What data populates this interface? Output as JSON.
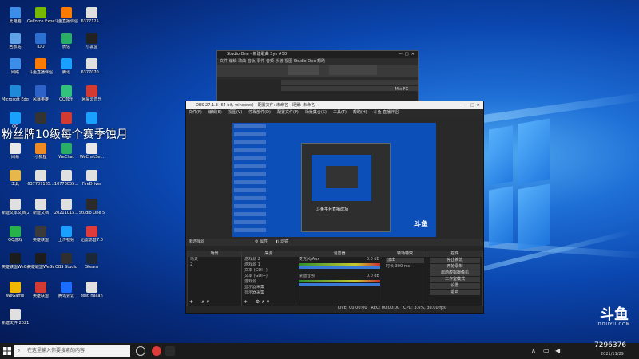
{
  "desktop_icons": [
    {
      "label": "此电脑",
      "color": "#3d8ee8"
    },
    {
      "label": "GeForce Experience",
      "color": "#76b900"
    },
    {
      "label": "斗鱼直播伴侣",
      "color": "#ff7a00"
    },
    {
      "label": "6377125...",
      "color": "#e0e0e0"
    },
    {
      "label": "回收站",
      "color": "#5fa2e8"
    },
    {
      "label": "IDO",
      "color": "#2b6fd1"
    },
    {
      "label": "微信",
      "color": "#2aae67"
    },
    {
      "label": "小黑盒",
      "color": "#222222"
    },
    {
      "label": "网络",
      "color": "#3d8ee8"
    },
    {
      "label": "斗鱼直播伴侣",
      "color": "#ff7a00"
    },
    {
      "label": "腾讯",
      "color": "#1aa1ff"
    },
    {
      "label": "6377070...",
      "color": "#e0e0e0"
    },
    {
      "label": "Microsoft Edge",
      "color": "#1f8ad8"
    },
    {
      "label": "风暴英雄",
      "color": "#2d62c9"
    },
    {
      "label": "QQ音乐",
      "color": "#31c27c"
    },
    {
      "label": "网易云音乐",
      "color": "#d33a31"
    },
    {
      "label": "QQ",
      "color": "#1aa1ff"
    },
    {
      "label": "",
      "color": "#333333"
    },
    {
      "label": "",
      "color": "#d33a31"
    },
    {
      "label": "",
      "color": "#1aa1ff"
    },
    {
      "label": "网易",
      "color": "#e8e8e8"
    },
    {
      "label": "小狐狸",
      "color": "#f08a24"
    },
    {
      "label": "WeChat",
      "color": "#2aae67"
    },
    {
      "label": "WeChatSe...",
      "color": "#e8e8e8"
    },
    {
      "label": "工具",
      "color": "#e6b84a"
    },
    {
      "label": "637707165...",
      "color": "#e0e0e0"
    },
    {
      "label": "10776055...",
      "color": "#e0e0e0"
    },
    {
      "label": "FireDriver",
      "color": "#e0e0e0"
    },
    {
      "label": "新建文本文档(2)",
      "color": "#e0e0e0"
    },
    {
      "label": "新建文档",
      "color": "#e0e0e0"
    },
    {
      "label": "20211015...",
      "color": "#e0e0e0"
    },
    {
      "label": "Studio One 5",
      "color": "#2b2b2b"
    },
    {
      "label": "QQ游戏",
      "color": "#28b34a"
    },
    {
      "label": "英雄联盟",
      "color": "#3a3a3a"
    },
    {
      "label": "上传视频",
      "color": "#1aa1ff"
    },
    {
      "label": "迅雷影音7.0",
      "color": "#e03b3b"
    },
    {
      "label": "英雄联盟WeGame版",
      "color": "#1c1c1c"
    },
    {
      "label": "英雄联盟WeGame版",
      "color": "#1c1c1c"
    },
    {
      "label": "OBS Studio",
      "color": "#2f2f2f"
    },
    {
      "label": "Steam",
      "color": "#1b2838"
    },
    {
      "label": "WeGame",
      "color": "#f2b600"
    },
    {
      "label": "英雄联盟",
      "color": "#d33a31"
    },
    {
      "label": "腾讯会议",
      "color": "#1a6dff"
    },
    {
      "label": "test_hallan",
      "color": "#e0e0e0"
    },
    {
      "label": "新建文件 20211103...",
      "color": "#e0e0e0"
    }
  ],
  "overlay_caption": "粉丝牌10级每个赛季蚀月",
  "small_window": {
    "title": "Studio One - 新建歌曲 Sys #50",
    "menu": "文件  编辑  歌曲  音轨  事件  音频  乐谱  视图  Studio One  帮助",
    "right_label": "Mix  FX"
  },
  "obs": {
    "title": "OBS 27.1.3 (64 bit, windows) - 配置文件: 未命名 - 场景: 未命名",
    "menu": [
      "文件(F)",
      "编辑(E)",
      "视图(V)",
      "停靠部件(D)",
      "配置文件(P)",
      "场景集合(S)",
      "工具(T)",
      "帮助(H)",
      "斗鱼·直播伴侣"
    ],
    "preview_caption": "斗鱼平台直播成功",
    "active_source": "未选择源",
    "props_btn": "属性",
    "filters_btn": "滤镜",
    "docks": {
      "scenes": {
        "title": "场景",
        "items": [
          "场景",
          "2"
        ]
      },
      "sources": {
        "title": "来源",
        "items": [
          "游戏源 2",
          "游戏源 1",
          "文本 (GDI+)",
          "文本 (GDI+)",
          "游戏源",
          "显示器采集",
          "显示器采集"
        ]
      },
      "mixer": {
        "title": "混音器",
        "tracks": [
          "麦克风/Aux",
          "桌面音频"
        ],
        "levels": [
          "0.0 dB",
          "0.0 dB"
        ]
      },
      "transitions": {
        "title": "转场特效",
        "type": "淡出",
        "duration_label": "时长",
        "duration": "300 ms"
      },
      "controls": {
        "title": "控件",
        "buttons": [
          "停止推流",
          "开始录制",
          "启动虚拟摄像机",
          "工作室模式",
          "设置",
          "退出"
        ]
      }
    },
    "status": {
      "live": "LIVE: 00:00:00",
      "rec": "REC: 00:00:00",
      "cpu": "CPU: 3.6%, 30.00 fps"
    }
  },
  "taskbar": {
    "search_placeholder": "在这里输入你要搜索的内容"
  },
  "watermark": {
    "logo": "斗鱼",
    "sub": "DOUYU.COM",
    "room": "7296376",
    "date": "2021/11/29"
  }
}
